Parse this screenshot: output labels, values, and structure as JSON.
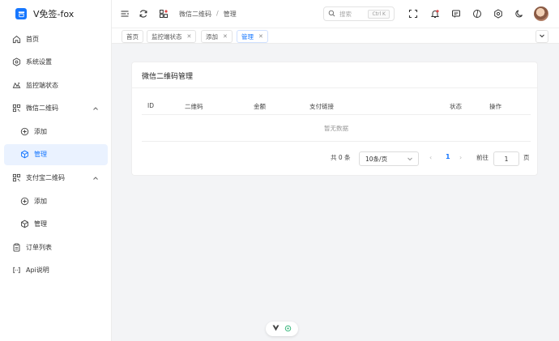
{
  "app": {
    "title": "V免签-fox",
    "accent": "#1677ff"
  },
  "sidebar": {
    "items": [
      {
        "label": "首页",
        "icon": "home-icon"
      },
      {
        "label": "系统设置",
        "icon": "settings-hex-icon"
      },
      {
        "label": "监控端状态",
        "icon": "monitor-status-icon"
      },
      {
        "label": "微信二维码",
        "icon": "qrcode-icon",
        "expanded": true
      },
      {
        "label": "添加",
        "icon": "plus-circle-icon",
        "sub": true
      },
      {
        "label": "管理",
        "icon": "cube-icon",
        "sub": true,
        "active": true
      },
      {
        "label": "支付宝二维码",
        "icon": "qrcode-icon",
        "expanded": true
      },
      {
        "label": "添加",
        "icon": "plus-circle-icon",
        "sub": true
      },
      {
        "label": "管理",
        "icon": "cube-icon",
        "sub": true
      },
      {
        "label": "订单列表",
        "icon": "clipboard-icon"
      },
      {
        "label": "Api说明",
        "icon": "code-brackets-icon"
      }
    ]
  },
  "header": {
    "breadcrumb": [
      "微信二维码",
      "管理"
    ],
    "breadcrumb_sep": "/",
    "search_placeholder": "搜索",
    "search_shortcut": "Ctrl K"
  },
  "tabs": [
    {
      "label": "首页",
      "closable": false
    },
    {
      "label": "监控端状态",
      "closable": true
    },
    {
      "label": "添加",
      "closable": true
    },
    {
      "label": "管理",
      "closable": true,
      "active": true
    }
  ],
  "card": {
    "title": "微信二维码管理",
    "columns": [
      "ID",
      "二维码",
      "金额",
      "支付链接",
      "状态",
      "操作"
    ],
    "empty_text": "暂无数据",
    "pagination": {
      "total_text": "共 0 条",
      "page_size": "10条/页",
      "current_page": "1",
      "goto_label": "前往",
      "goto_value": "1",
      "page_suffix": "页"
    }
  }
}
